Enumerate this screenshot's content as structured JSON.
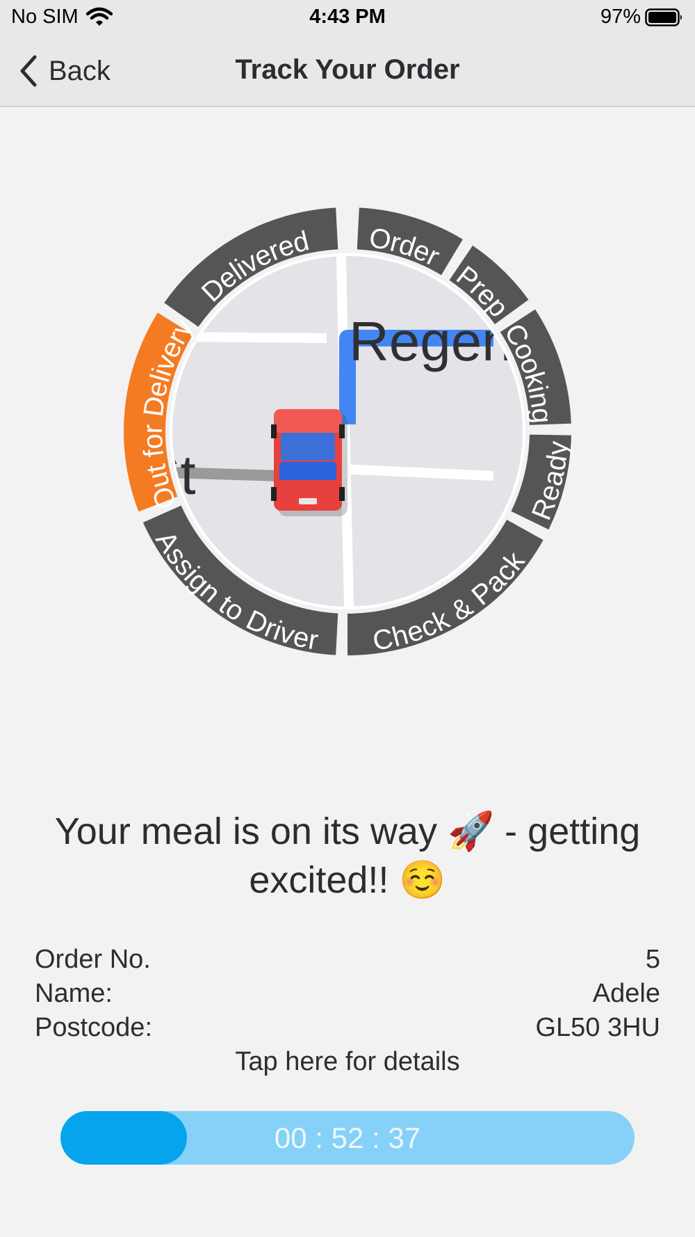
{
  "status_bar": {
    "carrier": "No SIM",
    "time": "4:43 PM",
    "battery": "97%"
  },
  "nav": {
    "back_label": "Back",
    "title": "Track Your Order"
  },
  "tracker": {
    "steps": [
      "Order",
      "Prep",
      "Cooking",
      "Ready",
      "Check & Pack",
      "Assign to Driver",
      "Out for Delivery",
      "Delivered"
    ],
    "active_step": "Out for Delivery",
    "map_street_label": "Regen",
    "map_street_label_2": "St",
    "colors": {
      "active": "#f47b22",
      "inactive": "#555555",
      "route": "#4286f4",
      "vehicle": "#e8403c"
    }
  },
  "message": "Your meal is on its way 🚀 - getting excited!! ☺️",
  "order": {
    "rows": [
      {
        "label": "Order No.",
        "value": "5"
      },
      {
        "label": "Name:",
        "value": "Adele"
      },
      {
        "label": "Postcode:",
        "value": "GL50 3HU"
      }
    ],
    "details_link": "Tap here for details"
  },
  "timer": {
    "time": "00 : 52 : 37",
    "progress": 0.22
  }
}
